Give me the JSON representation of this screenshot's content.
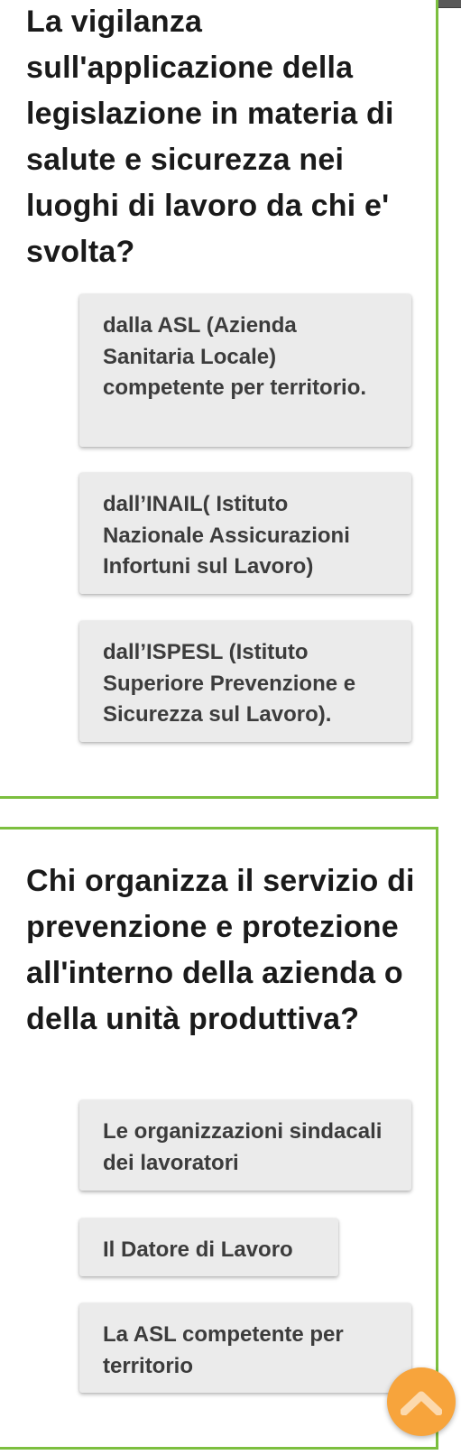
{
  "questions": [
    {
      "text": "La vigilanza sull'applicazione della legislazione in materia di salute e sicurezza nei luoghi di lavoro da chi e' svolta?",
      "answers": [
        "dalla ASL (Azienda Sanitaria Locale) competente per territorio.",
        "dall’INAIL( Istituto Nazionale Assicurazioni Infortuni sul Lavoro)",
        "dall’ISPESL (Istituto Superiore Prevenzione e Sicurezza sul Lavoro)."
      ]
    },
    {
      "text": "Chi organizza il servizio di prevenzione e protezione all'interno della azienda o della unità produttiva?",
      "answers": [
        "Le organizzazioni sindacali dei lavoratori",
        "Il Datore di Lavoro",
        "La ASL competente per territorio"
      ]
    }
  ],
  "scroll_top_button": {
    "icon": "chevron-up-icon"
  },
  "colors": {
    "card_border": "#7cbf3f",
    "answer_background": "#ebebeb",
    "answer_text": "#3c3c3c",
    "question_text": "#1a1a1a",
    "fab_background": "#f7a43c",
    "fab_icon": "#fcd9ad"
  }
}
